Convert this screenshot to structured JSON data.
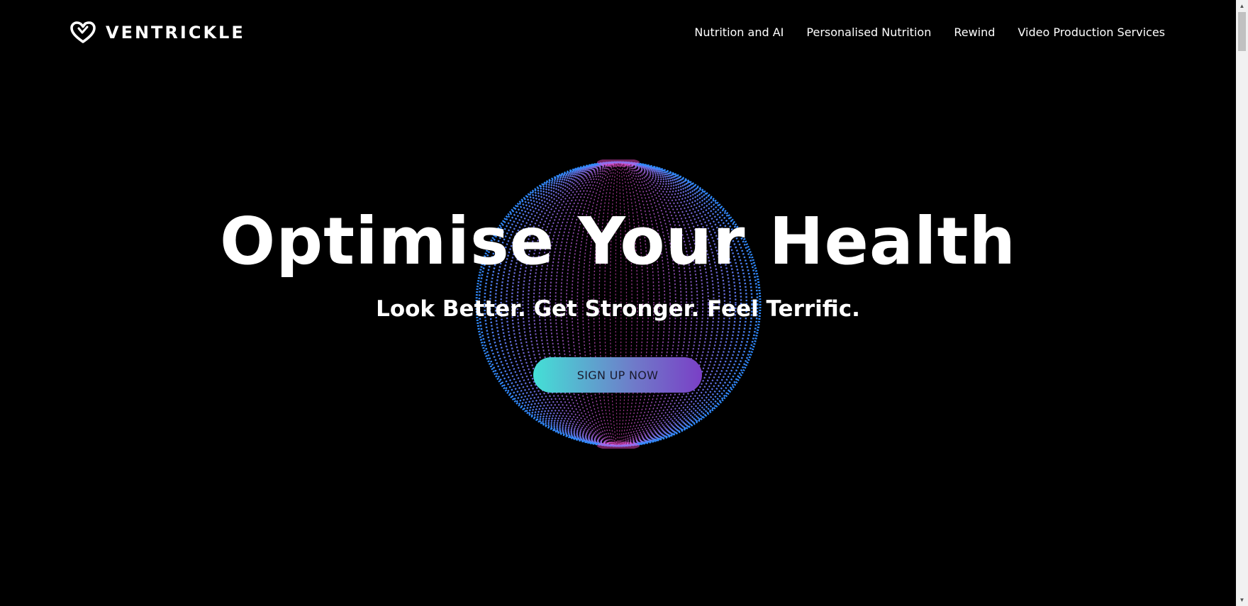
{
  "header": {
    "brand": "VENTRICKLE",
    "nav": [
      {
        "label": "Nutrition and AI"
      },
      {
        "label": "Personalised Nutrition"
      },
      {
        "label": "Rewind"
      },
      {
        "label": "Video Production Services"
      }
    ]
  },
  "hero": {
    "title": "Optimise Your Health",
    "subtitle": "Look Better. Get Stronger. Feel Terrific.",
    "cta_label": "SIGN UP NOW"
  },
  "colors": {
    "background": "#000000",
    "text": "#ffffff",
    "globe_outer": "#2f8cff",
    "globe_inner": "#ff4fd8",
    "cta_gradient_start": "#44e0d6",
    "cta_gradient_end": "#7a3fc6"
  },
  "icons": {
    "logo": "heart-logo-icon",
    "scroll_up": "scroll-up-arrow-icon",
    "scroll_down": "scroll-down-arrow-icon"
  }
}
